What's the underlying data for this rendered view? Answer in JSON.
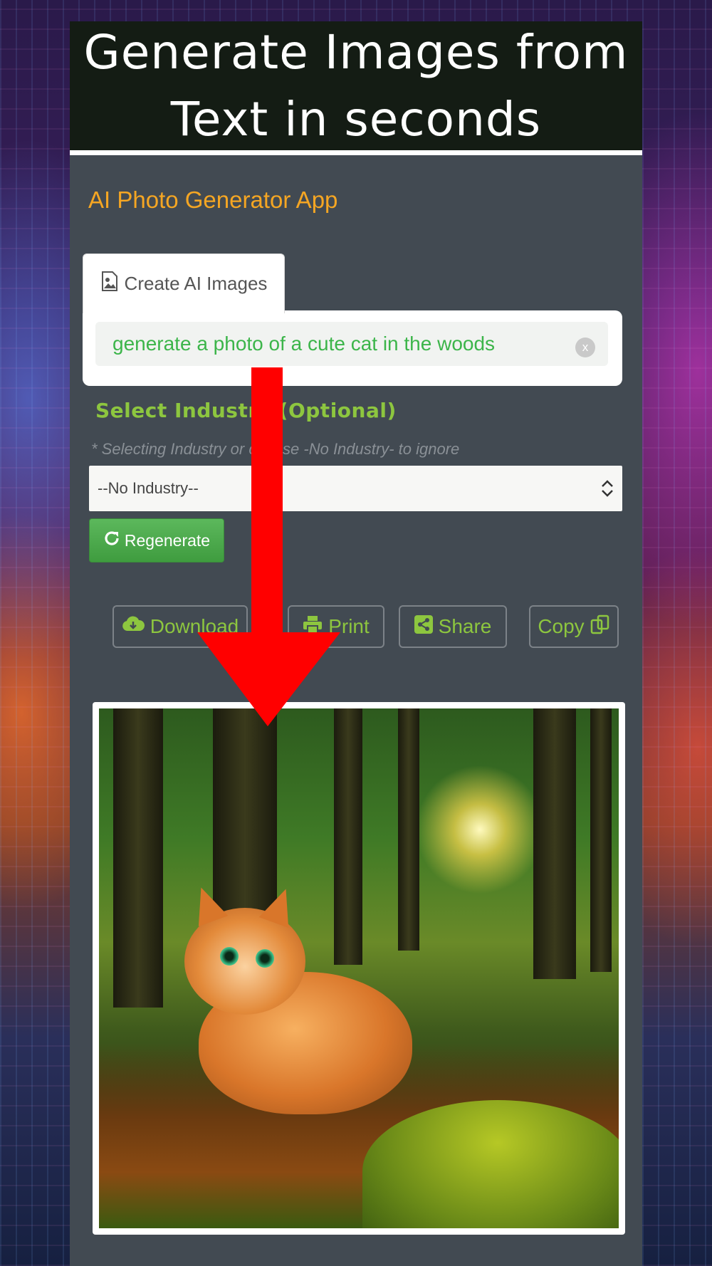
{
  "header": {
    "title": "Generate Images from Text in seconds"
  },
  "app": {
    "title": "AI Photo Generator App"
  },
  "tabs": [
    {
      "label": "Create AI Images",
      "icon": "image-file-icon"
    }
  ],
  "prompt": {
    "value": "generate a photo of a cute cat in the woods",
    "clear_label": "x"
  },
  "industry": {
    "label": "Select Industry (Optional)",
    "hint": "* Selecting Industry or choose -No Industry- to ignore",
    "selected": "--No Industry--"
  },
  "buttons": {
    "regenerate": "Regenerate",
    "download": "Download",
    "print": "Print",
    "share": "Share",
    "copy": "Copy"
  },
  "colors": {
    "accent_green": "#8dc63f",
    "title_orange": "#f5a623",
    "arrow_red": "#ff0000",
    "panel": "#424a52"
  }
}
